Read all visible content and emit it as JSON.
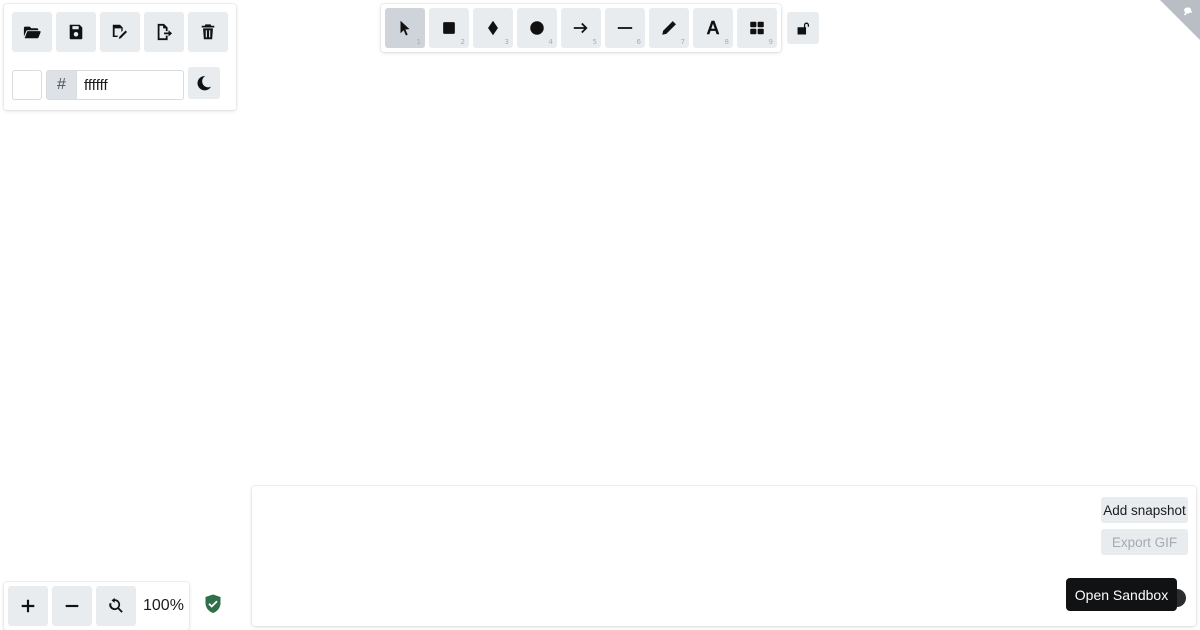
{
  "toolbar": {
    "tools": [
      {
        "name": "select",
        "icon": "cursor-arrow-icon",
        "key": "1",
        "active": true
      },
      {
        "name": "rectangle",
        "icon": "square-icon",
        "key": "2"
      },
      {
        "name": "diamond",
        "icon": "diamond-icon",
        "key": "3"
      },
      {
        "name": "ellipse",
        "icon": "circle-icon",
        "key": "4"
      },
      {
        "name": "arrow",
        "icon": "arrow-right-icon",
        "key": "5"
      },
      {
        "name": "line",
        "icon": "line-icon",
        "key": "6"
      },
      {
        "name": "draw",
        "icon": "pencil-icon",
        "key": "7"
      },
      {
        "name": "text",
        "icon": "letter-a-icon",
        "key": "8"
      },
      {
        "name": "library",
        "icon": "grid-icon",
        "key": "9"
      }
    ],
    "lock_icon": "unlock-icon"
  },
  "actions": {
    "buttons": [
      "folder-open-icon",
      "save-icon",
      "save-as-icon",
      "export-icon",
      "trash-icon"
    ],
    "background_color": {
      "hash": "#",
      "value": "ffffff",
      "swatch": "#ffffff"
    },
    "theme_icon": "moon-icon"
  },
  "snapshot_panel": {
    "add_snapshot_label": "Add snapshot",
    "export_gif_label": "Export GIF",
    "open_sandbox_label": "Open Sandbox"
  },
  "zoom": {
    "level": "100%",
    "zoom_in_icon": "plus-icon",
    "zoom_out_icon": "minus-icon",
    "reset_icon": "zoom-reset-icon"
  },
  "status": {
    "shield_icon": "shield-check-icon",
    "shield_color": "#2f6f4a"
  },
  "colors": {
    "button_bg": "#e9ecef",
    "active_bg": "#ced4da",
    "sandbox_bg": "#111214"
  }
}
